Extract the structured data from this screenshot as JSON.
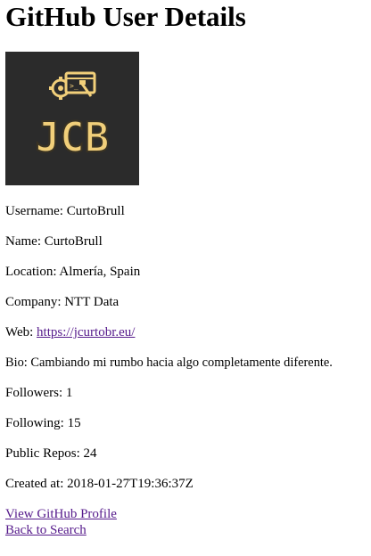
{
  "page": {
    "title": "GitHub User Details"
  },
  "avatar": {
    "logo_text": "JCB",
    "logo_colors": {
      "background": "#2b2b2b",
      "gold": "#f1cf7a",
      "dark_stroke": "#3a3323"
    }
  },
  "details": {
    "username_label": "Username:",
    "username_value": "CurtoBrull",
    "name_label": "Name:",
    "name_value": "CurtoBrull",
    "location_label": "Location:",
    "location_value": "Almería, Spain",
    "company_label": "Company:",
    "company_value": "NTT Data",
    "web_label": "Web:",
    "web_value": "https://jcurtobr.eu/",
    "bio_label": "Bio:",
    "bio_value": "Cambiando mi rumbo hacia algo completamente diferente.",
    "followers_label": "Followers:",
    "followers_value": "1",
    "following_label": "Following:",
    "following_value": "15",
    "repos_label": "Public Repos:",
    "repos_value": "24",
    "created_label": "Created at:",
    "created_value": "2018-01-27T19:36:37Z"
  },
  "links": {
    "profile_label": "View GitHub Profile",
    "back_label": "Back to Search"
  },
  "colors": {
    "link_visited": "#551a8b",
    "text": "#000000",
    "background": "#ffffff"
  }
}
